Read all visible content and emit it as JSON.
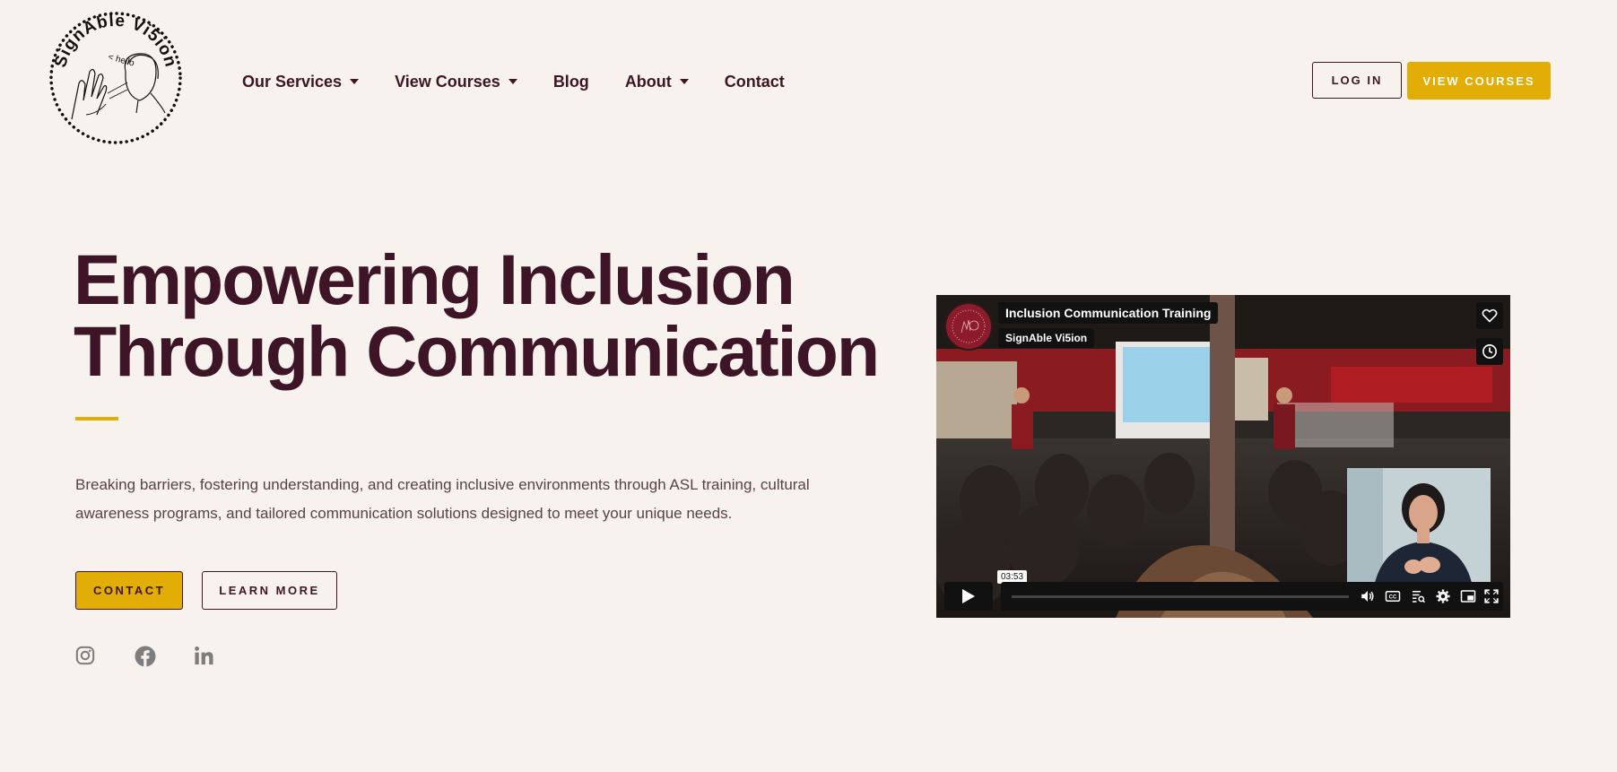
{
  "brand": {
    "logo_text": "SignAble Vi5ion",
    "logo_hello": "< hello"
  },
  "nav": {
    "items": [
      {
        "label": "Our Services",
        "dropdown": true
      },
      {
        "label": "View Courses",
        "dropdown": true
      },
      {
        "label": "Blog",
        "dropdown": false
      },
      {
        "label": "About",
        "dropdown": true
      },
      {
        "label": "Contact",
        "dropdown": false
      }
    ]
  },
  "header": {
    "login_label": "LOG IN",
    "view_courses_label": "VIEW COURSES"
  },
  "hero": {
    "title_line1": "Empowering Inclusion",
    "title_line2": "Through Communication",
    "description": "Breaking barriers, fostering understanding, and creating inclusive environments through ASL training, cultural awareness programs, and tailored communication solutions designed to meet your unique needs.",
    "contact_label": "CONTACT",
    "learn_more_label": "LEARN MORE"
  },
  "social": [
    "instagram-icon",
    "facebook-icon",
    "linkedin-icon"
  ],
  "video": {
    "title": "Inclusion Communication Training",
    "channel": "SignAble Vi5ion",
    "duration": "03:53"
  },
  "colors": {
    "accent": "#e2ad04",
    "brand": "#3d1526",
    "background": "#f8f2ee"
  }
}
